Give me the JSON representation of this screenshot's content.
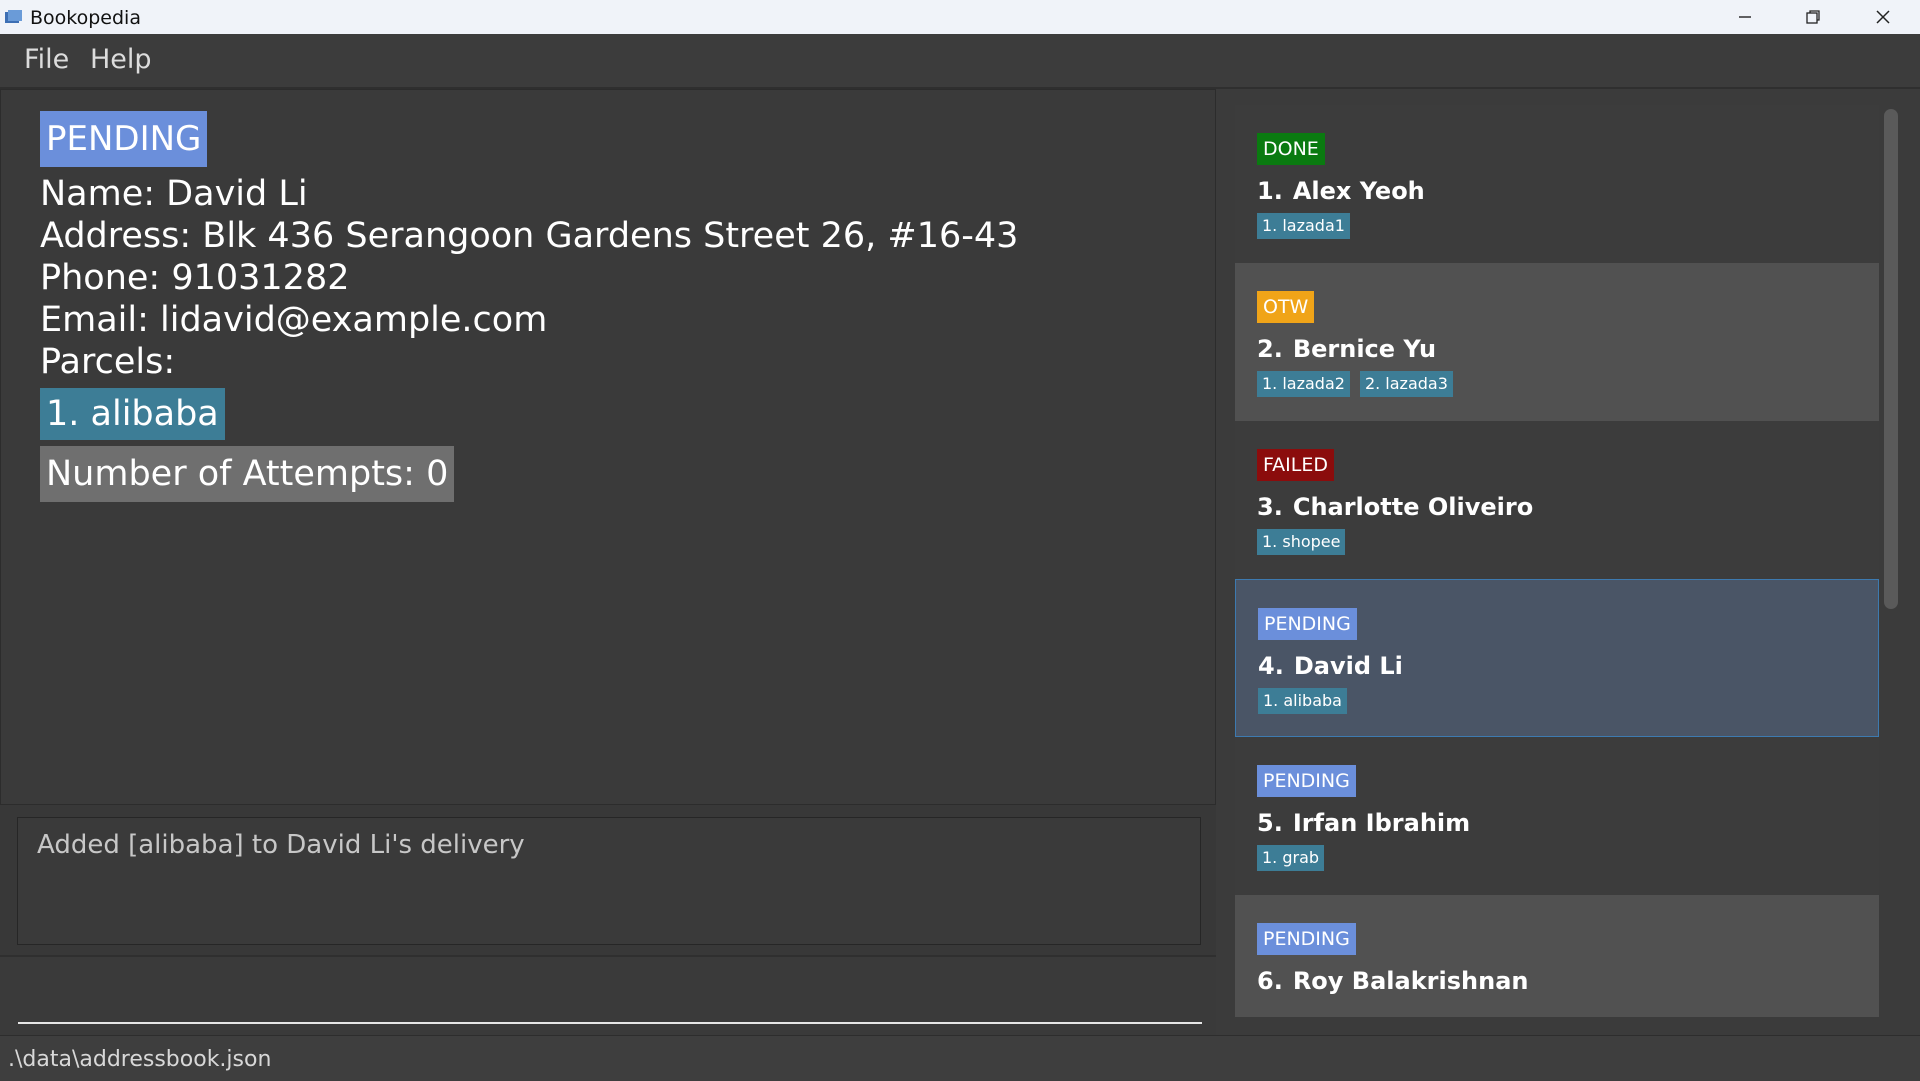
{
  "window": {
    "title": "Bookopedia"
  },
  "menu": {
    "items": [
      "File",
      "Help"
    ]
  },
  "detail": {
    "status": "PENDING",
    "name": "Name: David Li",
    "address": "Address: Blk 436 Serangoon Gardens Street 26, #16-43",
    "phone": "Phone: 91031282",
    "email": "Email: lidavid@example.com",
    "parcels_label": "Parcels:",
    "parcels": [
      "1. alibaba"
    ],
    "attempts": "Number of Attempts: 0"
  },
  "result": {
    "message": "Added [alibaba] to David Li's delivery"
  },
  "command": {
    "value": ""
  },
  "deliveries": [
    {
      "index": "1.",
      "name": "Alex Yeoh",
      "status": "DONE",
      "status_color": "#0a7a10",
      "parcels": [
        "1. lazada1"
      ]
    },
    {
      "index": "2.",
      "name": "Bernice Yu",
      "status": "OTW",
      "status_color": "#f0a418",
      "parcels": [
        "1. lazada2",
        "2. lazada3"
      ]
    },
    {
      "index": "3.",
      "name": "Charlotte Oliveiro",
      "status": "FAILED",
      "status_color": "#8b0c0c",
      "parcels": [
        "1. shopee"
      ]
    },
    {
      "index": "4.",
      "name": "David Li",
      "status": "PENDING",
      "status_color": "#6b8fdb",
      "parcels": [
        "1. alibaba"
      ]
    },
    {
      "index": "5.",
      "name": "Irfan Ibrahim",
      "status": "PENDING",
      "status_color": "#6b8fdb",
      "parcels": [
        "1. grab"
      ]
    },
    {
      "index": "6.",
      "name": "Roy Balakrishnan",
      "status": "PENDING",
      "status_color": "#6b8fdb",
      "parcels": []
    }
  ],
  "statusbar": {
    "path": ".\\data\\addressbook.json"
  },
  "icons": {
    "app": "app-icon",
    "minimize": "minimize-icon",
    "maximize": "restore-icon",
    "close": "close-icon"
  }
}
